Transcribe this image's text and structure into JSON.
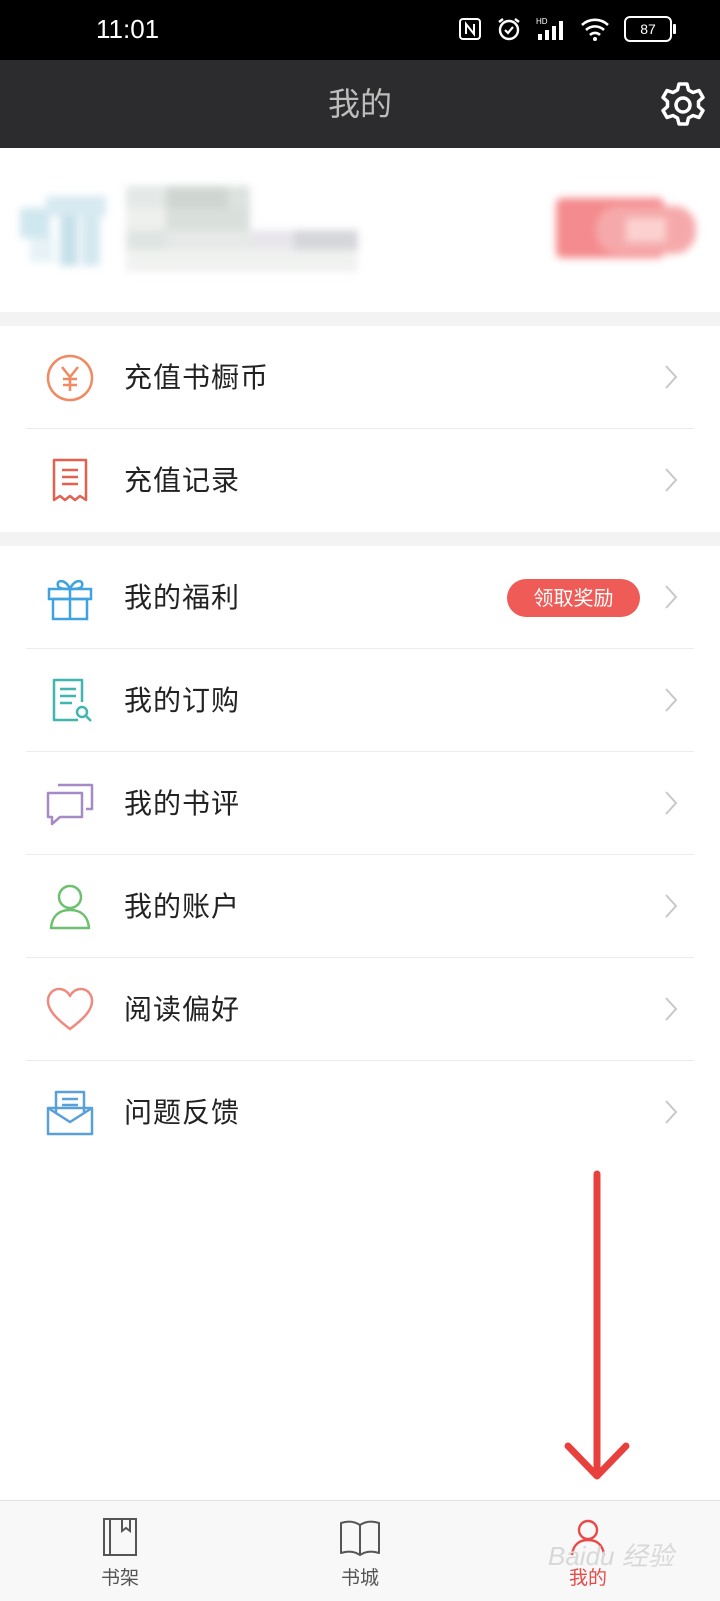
{
  "status_bar": {
    "time": "11:01",
    "battery": "87",
    "icons": [
      "nfc-icon",
      "alarm-icon",
      "hd-signal-icon",
      "wifi-icon",
      "battery-icon"
    ]
  },
  "header": {
    "title": "我的",
    "settings_icon": "gear-icon"
  },
  "colors": {
    "title_bar_bg": "#2c2c2f",
    "accent_red": "#e84b47",
    "reward_pill": "#ef5b56"
  },
  "menu_groups": [
    {
      "items": [
        {
          "label": "充值书橱币",
          "icon": "yen-coin-icon"
        },
        {
          "label": "充值记录",
          "icon": "receipt-icon"
        }
      ]
    },
    {
      "items": [
        {
          "label": "我的福利",
          "icon": "gift-icon",
          "badge": "领取奖励"
        },
        {
          "label": "我的订购",
          "icon": "order-list-icon"
        },
        {
          "label": "我的书评",
          "icon": "comment-icon"
        },
        {
          "label": "我的账户",
          "icon": "user-icon"
        },
        {
          "label": "阅读偏好",
          "icon": "heart-icon"
        },
        {
          "label": "问题反馈",
          "icon": "feedback-mail-icon"
        }
      ]
    }
  ],
  "bottom_nav": [
    {
      "label": "书架",
      "icon": "bookshelf-icon"
    },
    {
      "label": "书城",
      "icon": "book-open-icon"
    },
    {
      "label": "我的",
      "icon": "profile-icon",
      "active": true
    }
  ],
  "watermark": "Baidu 经验"
}
